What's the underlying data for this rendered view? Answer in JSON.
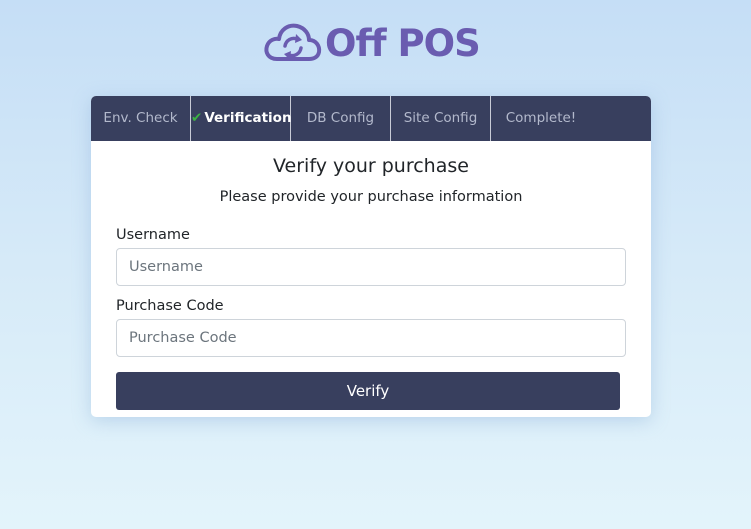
{
  "brand": {
    "name": "Off POS",
    "color": "#6a5cb0"
  },
  "tabs": [
    {
      "label": "Env. Check",
      "active": false
    },
    {
      "label": "Verification",
      "active": true,
      "icon": "check-icon"
    },
    {
      "label": "DB Config",
      "active": false
    },
    {
      "label": "Site Config",
      "active": false
    },
    {
      "label": "Complete!",
      "active": false
    }
  ],
  "form": {
    "heading": "Verify your purchase",
    "subheading": "Please provide your purchase information",
    "username_label": "Username",
    "username_placeholder": "Username",
    "username_value": "",
    "purchase_code_label": "Purchase Code",
    "purchase_code_placeholder": "Purchase Code",
    "purchase_code_value": "",
    "submit_label": "Verify"
  },
  "colors": {
    "header_bg": "#383f5e",
    "button_bg": "#383f5e",
    "check": "#3cb043"
  }
}
